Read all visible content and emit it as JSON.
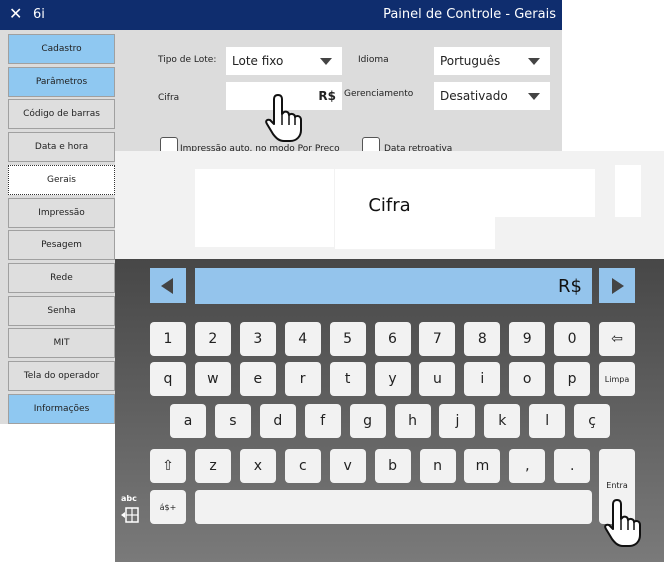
{
  "window": {
    "close_glyph": "✕",
    "app_id": "6i",
    "title": "Painel de Controle - Gerais"
  },
  "sidebar": {
    "items": [
      {
        "label": "Cadastro",
        "state": "highlight"
      },
      {
        "label": "Parâmetros",
        "state": "highlight"
      },
      {
        "label": "Código de barras",
        "state": "normal"
      },
      {
        "label": "Data e hora",
        "state": "normal"
      },
      {
        "label": "Gerais",
        "state": "selected"
      },
      {
        "label": "Impressão",
        "state": "normal"
      },
      {
        "label": "Pesagem",
        "state": "normal"
      },
      {
        "label": "Rede",
        "state": "normal"
      },
      {
        "label": "Senha",
        "state": "normal"
      },
      {
        "label": "MIT",
        "state": "normal"
      },
      {
        "label": "Tela do operador",
        "state": "normal"
      },
      {
        "label": "Informações",
        "state": "highlight"
      }
    ]
  },
  "form": {
    "tipo_lote_label": "Tipo de Lote:",
    "tipo_lote_value": "Lote fixo",
    "idioma_label": "Idioma",
    "idioma_value": "Português",
    "cifra_label": "Cifra",
    "cifra_value": "R$",
    "gerenciamento_label": "Gerenciamento",
    "gerenciamento_value": "Desativado",
    "impressao_checkbox_label": "Impressão auto. no modo Por Preço",
    "data_retro_checkbox_label": "Data retroativa"
  },
  "keyboard": {
    "title": "Cifra",
    "display_value": "R$",
    "row1": [
      "1",
      "2",
      "3",
      "4",
      "5",
      "6",
      "7",
      "8",
      "9",
      "0"
    ],
    "row2": [
      "q",
      "w",
      "e",
      "r",
      "t",
      "y",
      "u",
      "i",
      "o",
      "p"
    ],
    "row3": [
      "a",
      "s",
      "d",
      "f",
      "g",
      "h",
      "j",
      "k",
      "l",
      "ç"
    ],
    "row4": [
      "z",
      "x",
      "c",
      "v",
      "b",
      "n",
      "m",
      ",",
      "."
    ],
    "backspace_glyph": "⇦",
    "clear_label": "Limpa",
    "shift_glyph": "⇧",
    "symbols_label": "á$+",
    "enter_label": "Entra",
    "layout_label": "abc"
  },
  "colors": {
    "title_bar": "#0f2d6e",
    "highlight": "#8fc8f1",
    "key_accent": "#94c4ec"
  },
  "icons": [
    "close-icon",
    "dropdown-arrow-icon",
    "hand-cursor-icon",
    "arrow-left-icon",
    "arrow-right-icon",
    "backspace-icon",
    "shift-icon",
    "keyboard-layout-icon"
  ]
}
